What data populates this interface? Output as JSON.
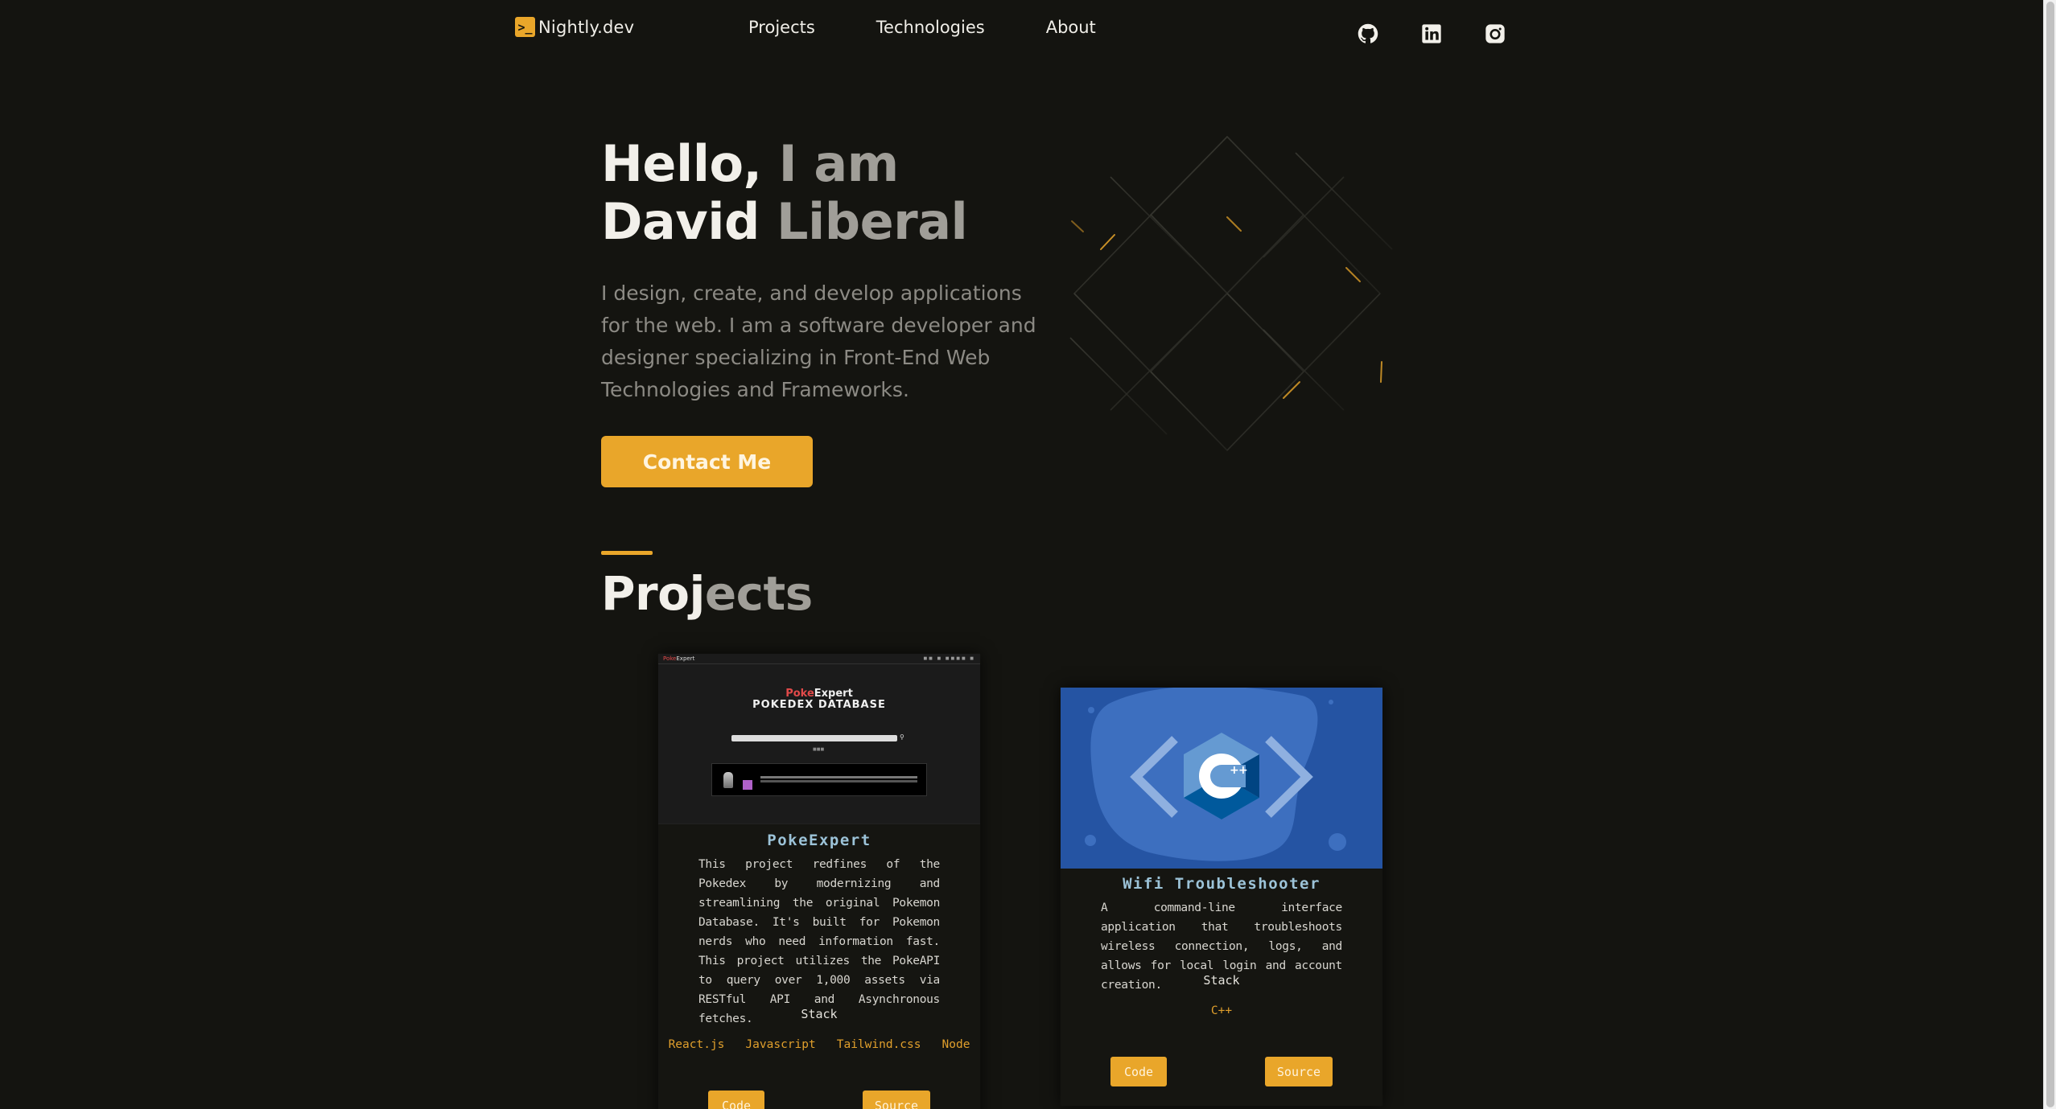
{
  "nav": {
    "brand": "Nightly.dev",
    "brand_icon": "terminal-icon",
    "links": [
      "Projects",
      "Technologies",
      "About"
    ],
    "socials": [
      "github-icon",
      "linkedin-icon",
      "instagram-icon"
    ]
  },
  "hero": {
    "line1_a": "Hello,",
    "line1_b": " I am",
    "line2_a": "D",
    "line2_b": "avid",
    "line2_c": " Liberal",
    "description": "I design, create, and develop applications for the web. I am a software developer and designer specializing in Front-End Web Technologies and Frameworks.",
    "cta": "Contact Me"
  },
  "projects_section": {
    "title_a": "Proj",
    "title_b": "ects"
  },
  "projects": [
    {
      "title": "PokeExpert",
      "preview": {
        "nav_brand_a": "Poke",
        "nav_brand_b": "Expert",
        "brand_a": "Poke",
        "brand_b": "Expert",
        "subtitle": "POKEDEX DATABASE"
      },
      "description": "This project redfines of the Pokedex by modernizing and streamlining the original Pokemon Database. It's built for Pokemon nerds who need information fast. This project utilizes the PokeAPI to query over 1,000 assets via RESTful API and Asynchronous fetches.",
      "stack_label": "Stack",
      "stack": [
        "React.js",
        "Javascript",
        "Tailwind.css",
        "Node"
      ],
      "code_label": "Code",
      "source_label": "Source"
    },
    {
      "title": "Wifi Troubleshooter",
      "image_icon": "cpp-logo-icon",
      "image_text": "C++",
      "description": "A command-line interface application that troubleshoots wireless connection, logs, and allows for local login and account creation.",
      "stack_label": "Stack",
      "stack": [
        "C++"
      ],
      "code_label": "Code",
      "source_label": "Source"
    }
  ],
  "colors": {
    "background": "#141410",
    "accent": "#e9a62a",
    "card_title": "#9cc3d8",
    "wifi_bg": "#2554a3"
  }
}
